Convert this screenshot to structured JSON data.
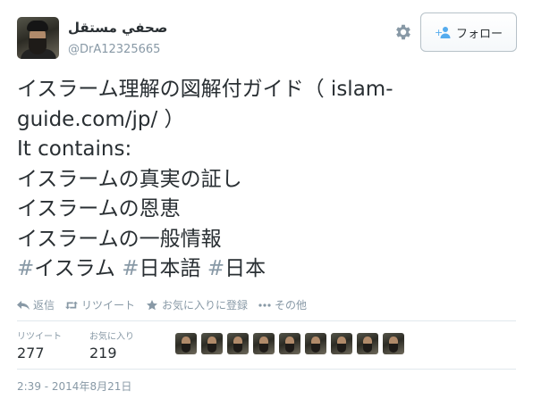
{
  "user": {
    "display_name": "صحفي مستقل",
    "screen_name": "@DrA12325665"
  },
  "follow_button": {
    "label": "フォロー"
  },
  "tweet": {
    "lines": [
      "イスラーム理解の図解付ガイド（ islam-",
      "guide.com/jp/ ）",
      "It contains:",
      "イスラームの真実の証し",
      "イスラームの恩恵",
      "イスラームの一般情報"
    ],
    "hashtags": [
      "イスラム",
      "日本語",
      "日本"
    ]
  },
  "actions": {
    "reply": "返信",
    "retweet": "リツイート",
    "favorite": "お気に入りに登録",
    "more": "その他"
  },
  "stats": {
    "retweets_label": "リツイート",
    "retweets_value": "277",
    "favorites_label": "お気に入り",
    "favorites_value": "219"
  },
  "timestamp": "2:39 - 2014年8月21日",
  "colors": {
    "text": "#292f33",
    "muted": "#8899a6",
    "border": "#e1e8ed",
    "follow_icon": "#55acee"
  },
  "icons": [
    "gear-icon",
    "person-add-icon",
    "reply-icon",
    "retweet-icon",
    "star-icon",
    "more-icon"
  ]
}
